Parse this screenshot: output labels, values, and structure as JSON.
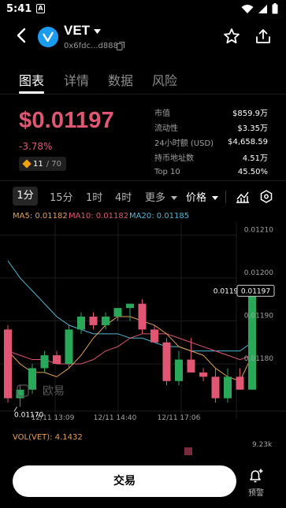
{
  "status_bar": {
    "time": "5:41",
    "badge": "A"
  },
  "header": {
    "token_name": "VET",
    "address": "0x6fdc...d888"
  },
  "tabs": [
    {
      "label": "图表",
      "active": true
    },
    {
      "label": "详情",
      "active": false
    },
    {
      "label": "数据",
      "active": false
    },
    {
      "label": "风险",
      "active": false
    }
  ],
  "price": {
    "value": "$0.01197",
    "change": "-3.78%",
    "score": "11",
    "score_total": "/ 70"
  },
  "stats": [
    {
      "label": "市值",
      "value": "$859.9万"
    },
    {
      "label": "流动性",
      "value": "$3.35万"
    },
    {
      "label": "24小时额 (USD)",
      "value": "$4,658.59"
    },
    {
      "label": "持币地址数",
      "value": "4.51万"
    },
    {
      "label": "Top 10",
      "value": "45.50%"
    }
  ],
  "intervals": {
    "items": [
      "1分",
      "15分",
      "1时",
      "4时"
    ],
    "more": "更多",
    "price_mode": "价格",
    "active_index": 0
  },
  "ma": {
    "ma5": "MA5: 0.01182",
    "ma10": "MA10: 0.01182",
    "ma20": "MA20: 0.01185",
    "colors": {
      "ma5": "#e8a14d",
      "ma10": "#e05673",
      "ma20": "#4fb6d6"
    }
  },
  "colors": {
    "up": "#29a859",
    "down": "#e05673",
    "accent": "#e05673"
  },
  "chart_data": {
    "type": "candlestick",
    "y_ticks": [
      "0.01210",
      "0.01200",
      "0.01190",
      "0.01180"
    ],
    "y_tick_values": [
      0.0121,
      0.012,
      0.0119,
      0.0118
    ],
    "ylim": [
      0.01169,
      0.01213
    ],
    "x_ticks": [
      "12/11 13:09",
      "12/11 14:40",
      "12/11 17:06"
    ],
    "price_tag": "0.01197",
    "current_label": "0.01197",
    "low_label": "0.01170",
    "watermark": "欧易",
    "candles": [
      {
        "o": 0.01188,
        "h": 0.01189,
        "l": 0.01171,
        "c": 0.01172
      },
      {
        "o": 0.01172,
        "h": 0.01175,
        "l": 0.0117,
        "c": 0.01174
      },
      {
        "o": 0.01174,
        "h": 0.0118,
        "l": 0.01173,
        "c": 0.01179
      },
      {
        "o": 0.01179,
        "h": 0.01183,
        "l": 0.01178,
        "c": 0.01182
      },
      {
        "o": 0.01182,
        "h": 0.01183,
        "l": 0.0118,
        "c": 0.0118
      },
      {
        "o": 0.0118,
        "h": 0.01189,
        "l": 0.01179,
        "c": 0.01188
      },
      {
        "o": 0.01188,
        "h": 0.01192,
        "l": 0.01187,
        "c": 0.01191
      },
      {
        "o": 0.01191,
        "h": 0.01192,
        "l": 0.01188,
        "c": 0.01189
      },
      {
        "o": 0.01189,
        "h": 0.01192,
        "l": 0.01188,
        "c": 0.01191
      },
      {
        "o": 0.01191,
        "h": 0.01193,
        "l": 0.0119,
        "c": 0.01193
      },
      {
        "o": 0.01193,
        "h": 0.01194,
        "l": 0.0119,
        "c": 0.01194
      },
      {
        "o": 0.01194,
        "h": 0.01195,
        "l": 0.01187,
        "c": 0.01188
      },
      {
        "o": 0.01188,
        "h": 0.01189,
        "l": 0.01185,
        "c": 0.01185
      },
      {
        "o": 0.01185,
        "h": 0.01186,
        "l": 0.01175,
        "c": 0.01176
      },
      {
        "o": 0.01176,
        "h": 0.01183,
        "l": 0.01175,
        "c": 0.01181
      },
      {
        "o": 0.01181,
        "h": 0.01186,
        "l": 0.01178,
        "c": 0.01178
      },
      {
        "o": 0.01178,
        "h": 0.01179,
        "l": 0.01176,
        "c": 0.01177
      },
      {
        "o": 0.01177,
        "h": 0.01179,
        "l": 0.01171,
        "c": 0.01172
      },
      {
        "o": 0.01172,
        "h": 0.01179,
        "l": 0.01171,
        "c": 0.01177
      },
      {
        "o": 0.01177,
        "h": 0.01179,
        "l": 0.01174,
        "c": 0.01174
      },
      {
        "o": 0.01174,
        "h": 0.01198,
        "l": 0.01174,
        "c": 0.01197
      }
    ],
    "ma5": [
      0.01183,
      0.0118,
      0.01178,
      0.01178,
      0.01177,
      0.01179,
      0.01182,
      0.01186,
      0.01189,
      0.01191,
      0.01191,
      0.0119,
      0.01189,
      0.01187,
      0.01184,
      0.01183,
      0.01182,
      0.01179,
      0.01177,
      0.01176,
      0.01182
    ],
    "ma10": [
      0.01183,
      0.01182,
      0.01181,
      0.01181,
      0.0118,
      0.0118,
      0.0118,
      0.01181,
      0.01183,
      0.01184,
      0.01186,
      0.01187,
      0.01187,
      0.01187,
      0.01186,
      0.01185,
      0.01184,
      0.01183,
      0.01182,
      0.01181,
      0.01182
    ],
    "ma20": [
      0.01204,
      0.012,
      0.01197,
      0.01194,
      0.01191,
      0.01189,
      0.01188,
      0.01187,
      0.01187,
      0.01187,
      0.01186,
      0.01186,
      0.01185,
      0.01184,
      0.01184,
      0.01183,
      0.01183,
      0.01183,
      0.01183,
      0.01183,
      0.01185
    ],
    "volume": {
      "label": "VOL(VET): 4.1432",
      "max_label": "9.23k"
    }
  },
  "bottom": {
    "trade": "交易",
    "alert": "预警"
  }
}
